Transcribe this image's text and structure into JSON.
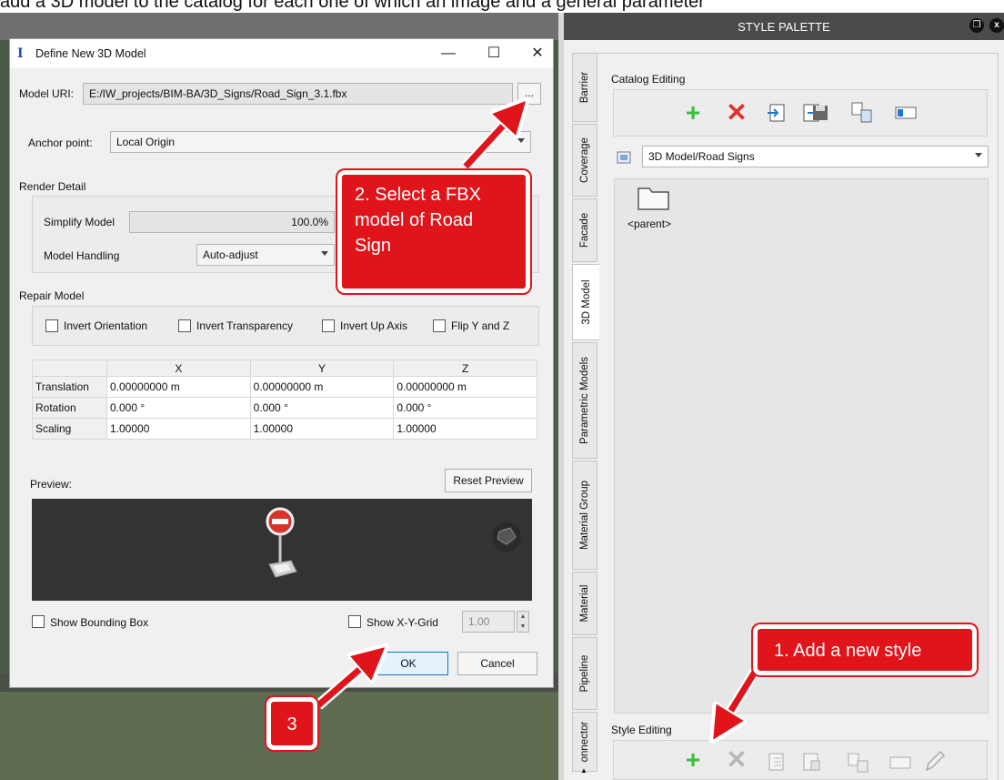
{
  "top_strip_text": "add a 3D model to the catalog for each one of which an image and a general parameter",
  "dialog": {
    "title": "Define New 3D Model",
    "model_uri_label": "Model URI:",
    "model_uri_value": "E:/IW_projects/BIM-BA/3D_Signs/Road_Sign_3.1.fbx",
    "browse_label": "...",
    "anchor_label": "Anchor point:",
    "anchor_value": "Local Origin",
    "render_detail_label": "Render Detail",
    "simplify_label": "Simplify Model",
    "simplify_value": "100.0%",
    "handling_label": "Model Handling",
    "handling_value": "Auto-adjust",
    "repair_label": "Repair Model",
    "repair_options": [
      "Invert Orientation",
      "Invert Transparency",
      "Invert Up Axis",
      "Flip Y and Z"
    ],
    "table": {
      "columns": [
        "X",
        "Y",
        "Z"
      ],
      "rows": [
        {
          "label": "Translation",
          "values": [
            "0.00000000 m",
            "0.00000000 m",
            "0.00000000 m"
          ]
        },
        {
          "label": "Rotation",
          "values": [
            "0.000 °",
            "0.000 °",
            "0.000 °"
          ]
        },
        {
          "label": "Scaling",
          "values": [
            "1.00000",
            "1.00000",
            "1.00000"
          ]
        }
      ]
    },
    "preview_label": "Preview:",
    "reset_preview_label": "Reset Preview",
    "show_bbox_label": "Show Bounding Box",
    "show_grid_label": "Show X-Y-Grid",
    "grid_value": "1.00",
    "ok_label": "OK",
    "cancel_label": "Cancel"
  },
  "palette": {
    "title": "STYLE PALETTE",
    "tabs": [
      "Barrier",
      "Coverage",
      "Facade",
      "3D Model",
      "Parametric Models",
      "Material Group",
      "Material",
      "Pipeline",
      "onnector"
    ],
    "active_tab": "3D Model",
    "catalog_editing_label": "Catalog Editing",
    "catalog_path": "3D Model/Road Signs",
    "parent_label": "<parent>",
    "style_editing_label": "Style Editing"
  },
  "callouts": {
    "c1": "1. Add a new style",
    "c2": "2. Select a FBX model of Road Sign",
    "c3": "3"
  },
  "colors": {
    "callout_red": "#e0141b",
    "green_plus": "#3bbf3b",
    "red_x": "#e03030",
    "palette_header": "#4a4a4a"
  }
}
